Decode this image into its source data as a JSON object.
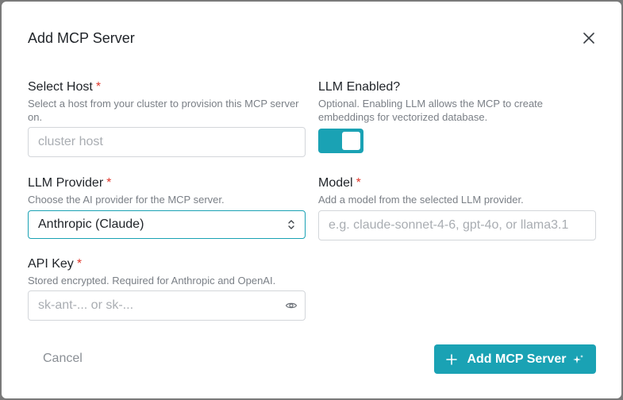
{
  "modal": {
    "title": "Add MCP Server"
  },
  "form": {
    "host": {
      "label": "Select Host",
      "required_marker": "*",
      "help": "Select a host from your cluster to provision this MCP server on.",
      "placeholder": "cluster host"
    },
    "llm_enabled": {
      "label": "LLM Enabled?",
      "help": "Optional. Enabling LLM allows the MCP to create embeddings for vectorized database.",
      "value": true
    },
    "provider": {
      "label": "LLM Provider",
      "required_marker": "*",
      "help": "Choose the AI provider for the MCP server.",
      "selected": "Anthropic (Claude)"
    },
    "model": {
      "label": "Model",
      "required_marker": "*",
      "help": "Add a model from the selected LLM provider.",
      "placeholder": "e.g. claude-sonnet-4-6, gpt-4o, or llama3.1"
    },
    "api_key": {
      "label": "API Key",
      "required_marker": "*",
      "help": "Stored encrypted. Required for Anthropic and OpenAI.",
      "placeholder": "sk-ant-... or sk-..."
    }
  },
  "footer": {
    "cancel_label": "Cancel",
    "submit_label": "Add MCP Server"
  },
  "colors": {
    "accent": "#1aa2b4",
    "required": "#e0382c",
    "help_text": "#7a7f86"
  },
  "icons": [
    "close-icon",
    "chevron-updown-icon",
    "eye-icon",
    "plus-icon",
    "sparkle-icon"
  ]
}
